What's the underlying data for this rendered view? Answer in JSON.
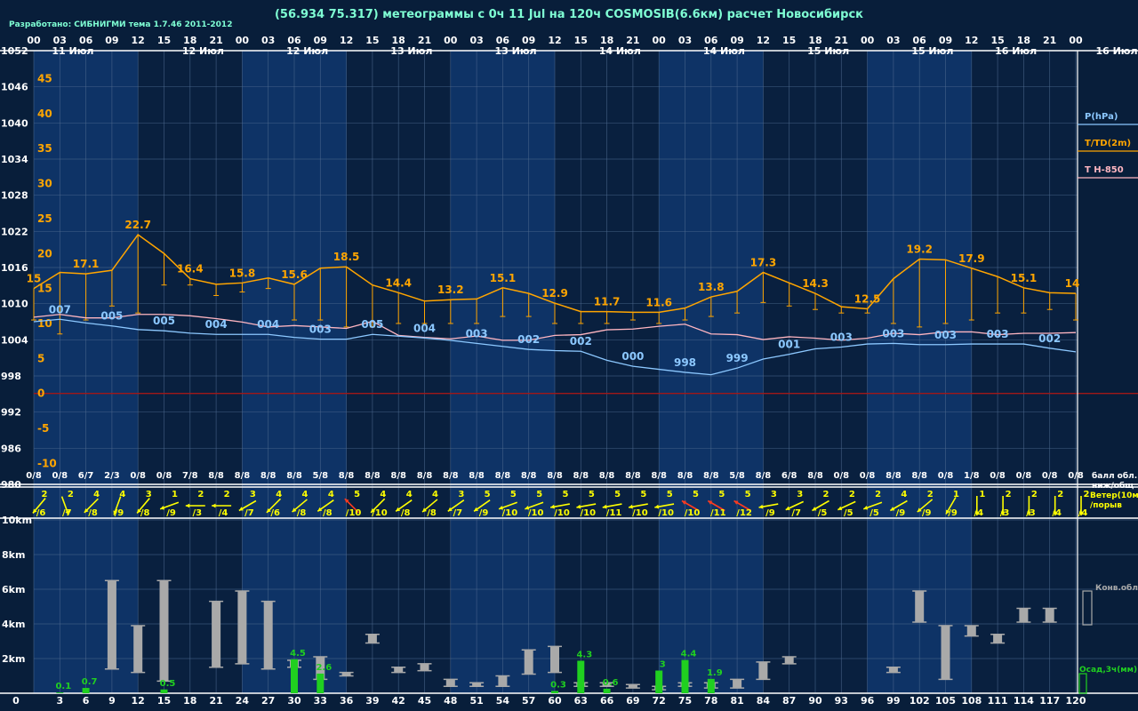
{
  "header": {
    "title": "(56.934 75.317) метеограммы с  0ч 11 Jul на 120ч COSMOSIB(6.6км) расчет Новосибирск",
    "credits": "Разработано: СИБНИГМИ тема 1.7.46 2011-2012"
  },
  "colors": {
    "background": "#081e3a",
    "day_band": "#0e3366",
    "night_band": "#09203f",
    "grid": "#4d6a8f",
    "temperature": "#ffa500",
    "pressure": "#8cc8ff",
    "t850": "#ffb6c1",
    "zero_line": "#a01818",
    "wind": "#ffff00",
    "wind_strong": "#ff3b1f",
    "cloud_bar": "#a9a9a9",
    "precip": "#20d020",
    "label_text": "#ffffff",
    "title_text": "#7fffd4"
  },
  "time_axis": {
    "hour_labels": [
      "00",
      "03",
      "06",
      "09",
      "12",
      "15",
      "18",
      "21",
      "00",
      "03",
      "06",
      "09",
      "12",
      "15",
      "18",
      "21",
      "00",
      "03",
      "06",
      "09",
      "12",
      "15",
      "18",
      "21",
      "00",
      "03",
      "06",
      "09",
      "12",
      "15",
      "18",
      "21",
      "00",
      "03",
      "06",
      "09",
      "12",
      "15",
      "18",
      "21",
      "00"
    ],
    "date_labels": [
      {
        "label": "11 Июл",
        "x": 0.5
      },
      {
        "label": "12 Июл",
        "x": 5.5
      },
      {
        "label": "12 Июл",
        "x": 9.5
      },
      {
        "label": "13 Июл",
        "x": 13.5
      },
      {
        "label": "13 Июл",
        "x": 17.5
      },
      {
        "label": "14 Июл",
        "x": 21.5
      },
      {
        "label": "14 Июл",
        "x": 25.5
      },
      {
        "label": "15 Июл",
        "x": 29.5
      },
      {
        "label": "15 Июл",
        "x": 33.5
      },
      {
        "label": "16 Июл",
        "x": 37.5
      }
    ],
    "end_date_label": "16 Июл",
    "day_bands": [
      [
        0,
        4
      ],
      [
        8,
        12
      ],
      [
        16,
        20
      ],
      [
        24,
        28
      ],
      [
        32,
        36
      ]
    ],
    "bottom_hours": [
      "3",
      "6",
      "9",
      "12",
      "15",
      "18",
      "21",
      "24",
      "27",
      "30",
      "33",
      "36",
      "39",
      "42",
      "45",
      "48",
      "51",
      "54",
      "57",
      "60",
      "63",
      "66",
      "69",
      "72",
      "75",
      "78",
      "81",
      "84",
      "87",
      "90",
      "93",
      "96",
      "99",
      "102",
      "105",
      "108",
      "111",
      "114",
      "117",
      "120"
    ]
  },
  "chart_data": [
    {
      "type": "line",
      "name": "meteogram-main",
      "x_unit": "forecast step (3h)",
      "pressure_axis": {
        "ticks": [
          1052,
          1046,
          1040,
          1034,
          1028,
          1022,
          1016,
          1010,
          1004,
          998,
          992,
          986,
          980
        ],
        "range": [
          980,
          1052
        ]
      },
      "temperature_axis": {
        "ticks": [
          45,
          40,
          35,
          30,
          25,
          20,
          15,
          10,
          5,
          0,
          -5,
          -10
        ],
        "range": [
          -13,
          49
        ]
      },
      "series": [
        {
          "name": "T/TD(2m)",
          "axis": "temperature",
          "values": [
            15,
            17.3,
            17.1,
            17.6,
            22.7,
            20,
            16.4,
            15.6,
            15.8,
            16.5,
            15.6,
            17.9,
            18.1,
            15.5,
            14.4,
            13.2,
            13.4,
            13.5,
            15.1,
            14.3,
            12.9,
            11.7,
            11.7,
            11.6,
            11.6,
            12.2,
            13.8,
            14.6,
            17.3,
            15.8,
            14.3,
            12.4,
            12.1,
            16.4,
            19.2,
            19.1,
            17.9,
            16.7,
            15.1,
            14.4,
            14.3
          ],
          "value_labels": [
            {
              "i": 0,
              "text": "15"
            },
            {
              "i": 2,
              "text": "17.1"
            },
            {
              "i": 4,
              "text": "22.7"
            },
            {
              "i": 6,
              "text": "16.4"
            },
            {
              "i": 8,
              "text": "15.8"
            },
            {
              "i": 10,
              "text": "15.6"
            },
            {
              "i": 12,
              "text": "18.5"
            },
            {
              "i": 14,
              "text": "14.4"
            },
            {
              "i": 16,
              "text": "13.2"
            },
            {
              "i": 18,
              "text": "15.1"
            },
            {
              "i": 20,
              "text": "12.9"
            },
            {
              "i": 22,
              "text": "11.7"
            },
            {
              "i": 24,
              "text": "11.6"
            },
            {
              "i": 26,
              "text": "13.8"
            },
            {
              "i": 28,
              "text": "17.3"
            },
            {
              "i": 30,
              "text": "14.3"
            },
            {
              "i": 32,
              "text": "12.5"
            },
            {
              "i": 34,
              "text": "19.2"
            },
            {
              "i": 36,
              "text": "17.9"
            },
            {
              "i": 38,
              "text": "15.1"
            },
            {
              "i": 40,
              "text": "14"
            }
          ]
        },
        {
          "name": "TD(2m)",
          "axis": "temperature",
          "values": [
            10.5,
            8.5,
            10.5,
            12.5,
            11.5,
            15.5,
            15.5,
            14,
            14.5,
            15,
            10.5,
            10.5,
            9.5,
            9.5,
            10,
            10,
            10,
            10,
            11,
            11,
            10,
            10,
            10,
            10.5,
            10,
            10.5,
            11,
            11.5,
            13,
            12.5,
            12,
            11.5,
            11.5,
            10,
            9.5,
            10,
            10.5,
            11.5,
            11.5,
            12,
            10.5
          ]
        },
        {
          "name": "P(hPa)",
          "axis": "pressure",
          "values": [
            1007,
            1007.4,
            1006.8,
            1006.3,
            1005.7,
            1005.5,
            1005.1,
            1004.9,
            1004.9,
            1004.9,
            1004.4,
            1004.1,
            1004.1,
            1004.9,
            1004.6,
            1004.3,
            1003.9,
            1003.4,
            1002.9,
            1002.4,
            1002.2,
            1002.1,
            1000.6,
            999.6,
            999.1,
            998.6,
            998.2,
            999.3,
            1000.8,
            1001.6,
            1002.5,
            1002.8,
            1003.3,
            1003.4,
            1003.2,
            1003.2,
            1003.3,
            1003.3,
            1003.3,
            1002.6,
            1002.0
          ],
          "value_labels": [
            {
              "i": 1,
              "text": "007"
            },
            {
              "i": 3,
              "text": "005"
            },
            {
              "i": 5,
              "text": "005"
            },
            {
              "i": 7,
              "text": "004"
            },
            {
              "i": 9,
              "text": "004"
            },
            {
              "i": 11,
              "text": "003"
            },
            {
              "i": 13,
              "text": "005"
            },
            {
              "i": 15,
              "text": "004"
            },
            {
              "i": 17,
              "text": "003"
            },
            {
              "i": 19,
              "text": "002"
            },
            {
              "i": 21,
              "text": "002"
            },
            {
              "i": 23,
              "text": "000"
            },
            {
              "i": 25,
              "text": "998"
            },
            {
              "i": 27,
              "text": "999"
            },
            {
              "i": 29,
              "text": "001"
            },
            {
              "i": 31,
              "text": "003"
            },
            {
              "i": 33,
              "text": "003"
            },
            {
              "i": 35,
              "text": "003"
            },
            {
              "i": 37,
              "text": "003"
            },
            {
              "i": 39,
              "text": "002"
            }
          ]
        },
        {
          "name": "T H-850",
          "axis": "temperature",
          "values": [
            10.9,
            11.3,
            10.8,
            10.8,
            11.3,
            11.3,
            11.1,
            10.7,
            10.2,
            9.5,
            9.7,
            9.5,
            9.3,
            10.3,
            8.3,
            8.0,
            7.8,
            8.2,
            7.6,
            7.6,
            8.3,
            8.4,
            9.1,
            9.2,
            9.6,
            9.9,
            8.5,
            8.4,
            7.7,
            8.1,
            7.9,
            7.6,
            7.9,
            8.6,
            8.4,
            8.8,
            8.8,
            8.4,
            8.6,
            8.6,
            8.7
          ]
        }
      ],
      "cloud_row": [
        "0/8",
        "0/8",
        "6/7",
        "2/3",
        "0/8",
        "0/8",
        "7/8",
        "8/8",
        "8/8",
        "8/8",
        "8/8",
        "5/8",
        "8/8",
        "8/8",
        "8/8",
        "8/8",
        "8/8",
        "8/8",
        "8/8",
        "8/8",
        "8/8",
        "8/8",
        "8/8",
        "8/8",
        "8/8",
        "8/8",
        "8/8",
        "5/8",
        "8/8",
        "6/8",
        "8/8",
        "0/8",
        "0/8",
        "8/8",
        "8/8",
        "0/8",
        "1/8",
        "0/8",
        "0/8",
        "0/8",
        "0/8"
      ],
      "legend": [
        "P(hPa)",
        "T/TD(2m)",
        "T H-850"
      ],
      "cloud_caption_1": "балл обл.",
      "cloud_caption_2": "ниж/общ"
    },
    {
      "type": "wind",
      "name": "wind-strip",
      "x_unit": "forecast step (3h)",
      "speed_mps": [
        2,
        2,
        4,
        4,
        3,
        1,
        2,
        2,
        3,
        4,
        4,
        4,
        5,
        4,
        4,
        4,
        3,
        5,
        5,
        5,
        5,
        5,
        5,
        5,
        5,
        5,
        5,
        5,
        3,
        3,
        2,
        2,
        2,
        4,
        2,
        1,
        1,
        2,
        2,
        2,
        2
      ],
      "gust_mps": [
        6,
        7,
        8,
        9,
        8,
        9,
        3,
        4,
        7,
        6,
        8,
        8,
        10,
        10,
        8,
        8,
        7,
        9,
        10,
        10,
        10,
        10,
        11,
        10,
        10,
        10,
        11,
        12,
        9,
        7,
        5,
        5,
        5,
        9,
        9,
        9,
        4,
        3,
        3,
        4,
        4
      ],
      "direction_deg": [
        220,
        160,
        225,
        200,
        220,
        250,
        270,
        270,
        240,
        225,
        230,
        235,
        315,
        225,
        235,
        230,
        235,
        235,
        250,
        250,
        260,
        260,
        260,
        260,
        260,
        300,
        300,
        300,
        260,
        245,
        240,
        245,
        250,
        240,
        230,
        210,
        180,
        180,
        180,
        180,
        180
      ],
      "strong_from_speed": 5,
      "caption_1": "Ветер(10м)",
      "caption_2": "/порыв"
    },
    {
      "type": "bar",
      "name": "cloud-precip",
      "x": [
        3,
        6,
        9,
        12,
        15,
        18,
        21,
        24,
        27,
        30,
        33,
        36,
        39,
        42,
        45,
        48,
        51,
        54,
        57,
        60,
        63,
        66,
        69,
        72,
        75,
        78,
        81,
        84,
        87,
        90,
        93,
        96,
        99,
        102,
        105,
        108,
        111,
        114,
        117,
        120
      ],
      "y_axis": {
        "ticks": [
          "10km",
          "8km",
          "6km",
          "4km",
          "2km"
        ],
        "range_km": [
          0,
          10
        ]
      },
      "conv_clouds_km": [
        [
          0,
          0
        ],
        [
          0,
          0
        ],
        [
          1.4,
          6.5
        ],
        [
          1.2,
          3.9
        ],
        [
          0.7,
          6.5
        ],
        [
          0,
          0
        ],
        [
          1.5,
          5.3
        ],
        [
          1.7,
          5.9
        ],
        [
          1.4,
          5.3
        ],
        [
          1.5,
          1.9
        ],
        [
          0.8,
          2.1
        ],
        [
          1.0,
          1.2
        ],
        [
          2.9,
          3.4
        ],
        [
          1.2,
          1.5
        ],
        [
          1.3,
          1.7
        ],
        [
          0.4,
          0.8
        ],
        [
          0.4,
          0.6
        ],
        [
          0.4,
          1.0
        ],
        [
          1.1,
          2.5
        ],
        [
          1.2,
          2.7
        ],
        [
          0.4,
          0.6
        ],
        [
          0.4,
          0.6
        ],
        [
          0.3,
          0.5
        ],
        [
          0.2,
          0.4
        ],
        [
          0.4,
          0.6
        ],
        [
          0.3,
          0.6
        ],
        [
          0.3,
          0.8
        ],
        [
          0.8,
          1.8
        ],
        [
          1.7,
          2.1
        ],
        [
          0,
          0
        ],
        [
          0,
          0
        ],
        [
          0,
          0
        ],
        [
          1.2,
          1.5
        ],
        [
          4.1,
          5.9
        ],
        [
          0.8,
          3.9
        ],
        [
          3.3,
          3.9
        ],
        [
          2.9,
          3.4
        ],
        [
          4.1,
          4.9
        ],
        [
          4.1,
          4.9
        ],
        [
          0,
          0
        ]
      ],
      "precip_mm": [
        0.1,
        0.7,
        0,
        0,
        0.5,
        0,
        0,
        0,
        0,
        4.5,
        2.6,
        0,
        0,
        0,
        0,
        0,
        0,
        0,
        0,
        0.3,
        4.3,
        0.6,
        0,
        3,
        4.4,
        1.9,
        0,
        0,
        0,
        0,
        0,
        0,
        0,
        0,
        0,
        0,
        0,
        0,
        0,
        0
      ],
      "precip_labels": [
        {
          "x": 3,
          "text": "0.1"
        },
        {
          "x": 6,
          "text": "0.7"
        },
        {
          "x": 15,
          "text": "0.5"
        },
        {
          "x": 30,
          "text": "4.5"
        },
        {
          "x": 33,
          "text": "2.6"
        },
        {
          "x": 60,
          "text": "0.3"
        },
        {
          "x": 63,
          "text": "4.3"
        },
        {
          "x": 66,
          "text": "0.6"
        },
        {
          "x": 72,
          "text": "3"
        },
        {
          "x": 75,
          "text": "4.4"
        },
        {
          "x": 78,
          "text": "1.9"
        }
      ],
      "legend_conv": "Конв.обл.",
      "legend_precip": "Осад,3ч(мм)"
    }
  ]
}
